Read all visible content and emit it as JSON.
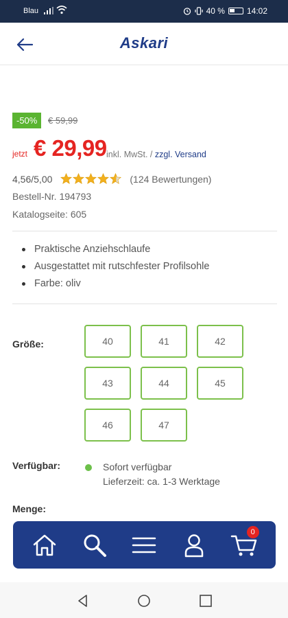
{
  "status_bar": {
    "carrier": "Blau",
    "battery": "40 %",
    "time": "14:02"
  },
  "header": {
    "logo": "Askari"
  },
  "product": {
    "discount_badge": "-50%",
    "old_price": "€ 59,99",
    "price_prefix": "jetzt",
    "price": "€ 29,99",
    "vat_text": "inkl. MwSt. / ",
    "shipping_link": "zzgl. Versand",
    "rating_value": "4,56/5,00",
    "rating_stars": 4.56,
    "reviews": "(124 Bewertungen)",
    "order_number": "Bestell-Nr. 194793",
    "catalog_page": "Katalogseite: 605",
    "features": [
      "Praktische Anziehschlaufe",
      "Ausgestattet mit rutschfester Profilsohle",
      "Farbe: oliv"
    ]
  },
  "size": {
    "label": "Größe:",
    "options": [
      "40",
      "41",
      "42",
      "43",
      "44",
      "45",
      "46",
      "47"
    ]
  },
  "availability": {
    "label": "Verfügbar:",
    "status": "Sofort verfügbar",
    "delivery": "Lieferzeit: ca. 1-3 Werktage",
    "color": "#6cc04a"
  },
  "quantity": {
    "label": "Menge:"
  },
  "bottom_nav": {
    "items": [
      "home-icon",
      "search-icon",
      "menu-icon",
      "account-icon",
      "cart-icon"
    ],
    "cart_count": "0"
  },
  "colors": {
    "brand": "#1f3c88",
    "sale": "#e52421",
    "accent": "#5ab431"
  }
}
